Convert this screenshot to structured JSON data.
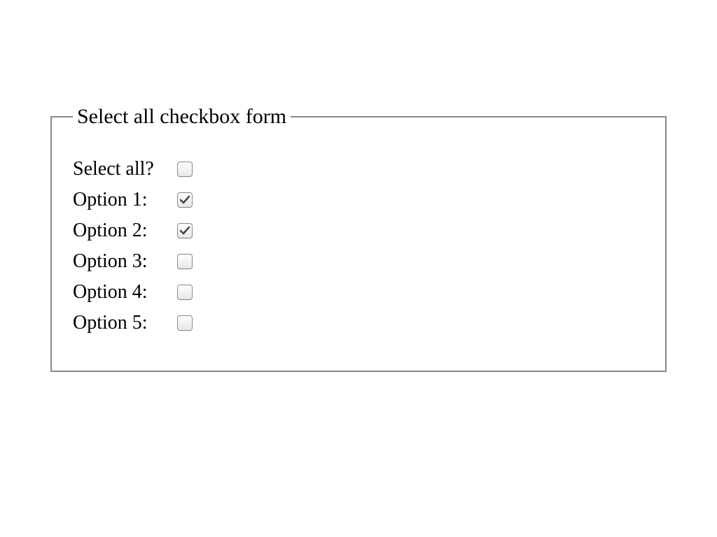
{
  "form": {
    "legend": "Select all checkbox form",
    "select_all": {
      "label": "Select all?",
      "checked": false
    },
    "options": [
      {
        "label": "Option 1:",
        "checked": true
      },
      {
        "label": "Option 2:",
        "checked": true
      },
      {
        "label": "Option 3:",
        "checked": false
      },
      {
        "label": "Option 4:",
        "checked": false
      },
      {
        "label": "Option 5:",
        "checked": false
      }
    ]
  }
}
